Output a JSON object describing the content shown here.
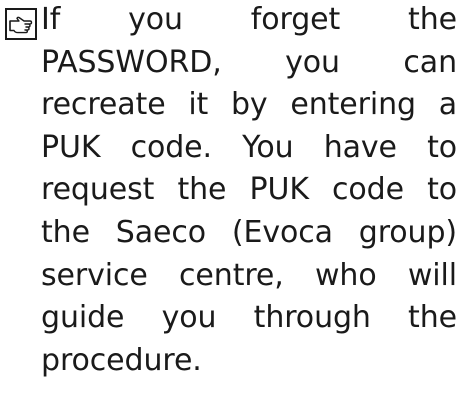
{
  "note": {
    "icon": "pointing-hand-note-icon",
    "text": "If you forget the PASSWORD, you can recreate it by entering a PUK code. You have to request the PUK code to the Saeco (Evoca group) service centre, who will guide you through the procedure."
  }
}
